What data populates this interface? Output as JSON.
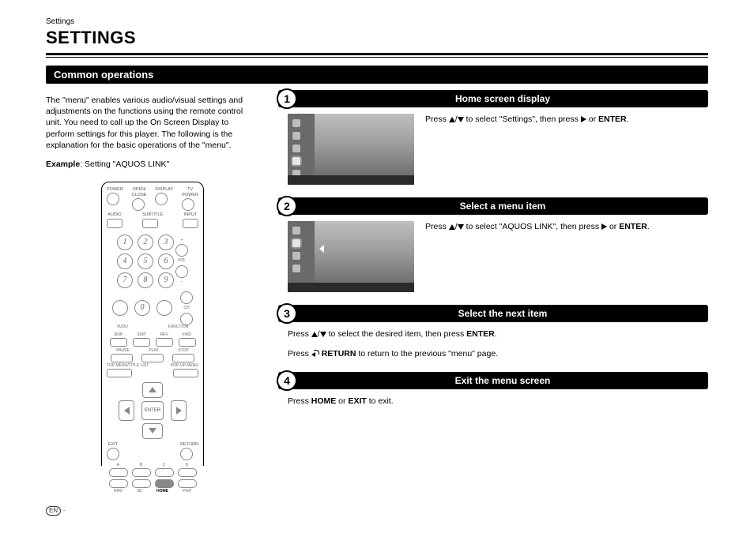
{
  "breadcrumb": "Settings",
  "page_title": "SETTINGS",
  "section_title": "Common operations",
  "intro_text": "The \"menu\" enables various audio/visual settings and adjustments on the functions using the remote control unit. You need to call up the On Screen Display to perform settings for this player. The following is the explanation for the basic operations of the \"menu\".",
  "example_label": "Example",
  "example_text": ": Setting \"AQUOS LINK\"",
  "steps": [
    {
      "num": "1",
      "title": "Home screen display",
      "press_prefix": "Press ",
      "mid": " to select \"Settings\", then press ",
      "suffix": " or ",
      "enter": "ENTER",
      "tail": "."
    },
    {
      "num": "2",
      "title": "Select a menu item",
      "press_prefix": "Press ",
      "mid": " to select \"AQUOS LINK\", then press ",
      "suffix": " or ",
      "enter": "ENTER",
      "tail": "."
    },
    {
      "num": "3",
      "title": "Select the next item",
      "press_prefix": "Press ",
      "mid": " to select the desired item, then press ",
      "enter": "ENTER",
      "tail": ".",
      "line2_prefix": "Press ",
      "line2_return": "RETURN",
      "line2_suffix": "  to return to the previous \"menu\" page."
    },
    {
      "num": "4",
      "title": "Exit the menu screen",
      "line_prefix": "Press ",
      "home": "HOME",
      "mid2": " or ",
      "exit": "EXIT",
      "tail": " to exit."
    }
  ],
  "remote": {
    "top_labels": [
      "POWER",
      "OPEN/\nCLOSE",
      "DISPLAY",
      "TV\nPOWER"
    ],
    "row2_labels": [
      "AUDIO",
      "SUBTITLE",
      "INPUT"
    ],
    "bottom_labels": [
      "TOP MENU/TITLE LIST",
      "POP-UP MENU"
    ],
    "exit": "EXIT",
    "return": "RETURN",
    "enter": "ENTER",
    "abcd": [
      "A",
      "B",
      "C",
      "D"
    ],
    "bottom2": [
      "RHD",
      "3D",
      "HOME",
      "PinP"
    ],
    "vol": "VOL",
    "ch": "CH",
    "vudu": "VUDU",
    "funct": "FUNCTION",
    "transport": [
      "SKIP",
      "SKIP",
      "REV",
      "FWD"
    ],
    "transport2": [
      "PAUSE",
      "PLAY",
      "STOP"
    ]
  },
  "footer_lang": "EN"
}
